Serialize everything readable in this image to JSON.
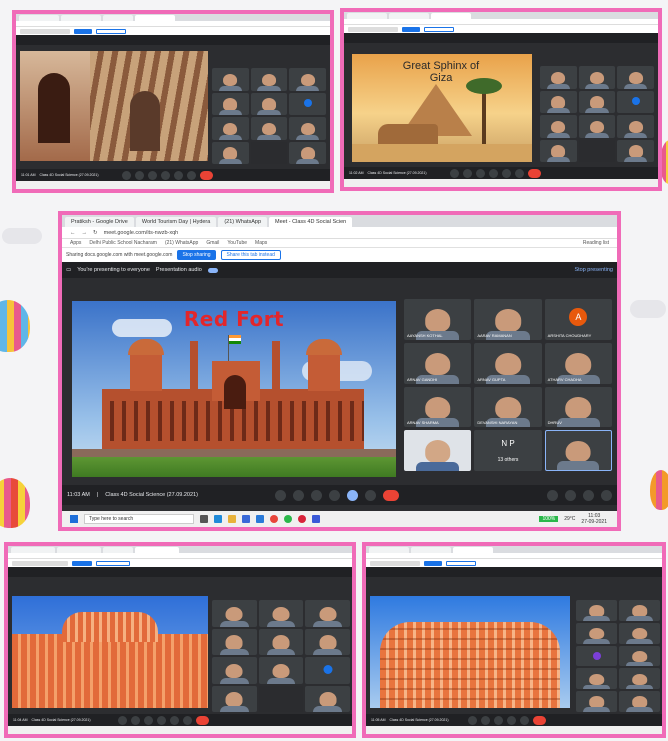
{
  "main": {
    "tabs": [
      "Pratiksh - Google Drive",
      "World Tourism Day | Hydera",
      "(21) WhatsApp",
      "Meet - Class 4D Social Scien"
    ],
    "url": "meet.google.com/its-nwzb-xqh",
    "bookmarks": [
      "Apps",
      "Delhi Public School Nacharam",
      "(21) WhatsApp",
      "Gmail",
      "YouTube",
      "Maps",
      "Reading list"
    ],
    "share_text": "Sharing docs.google.com with meet.google.com",
    "stop_label": "Stop sharing",
    "share_tab_label": "Share this tab instead",
    "presenting_text": "You're presenting to everyone",
    "audio_label": "Presentation audio",
    "stop_presenting": "Stop presenting",
    "slide_title": "Red Fort",
    "participants": [
      {
        "name": "AAYANSH KOTHAL"
      },
      {
        "name": "AARAV RAMANAN"
      },
      {
        "name": "ARSHITA CHOUDHARY",
        "initial": "A"
      },
      {
        "name": "ARNAV GANDHI"
      },
      {
        "name": "ARNAV GUPTA"
      },
      {
        "name": "ATHARV CHADHA"
      },
      {
        "name": "ARNAV SHARMA"
      },
      {
        "name": "DEVANSHI NARAYAN"
      },
      {
        "name": "DHRUV"
      },
      {
        "name": ""
      },
      {
        "name": "13 others",
        "initials": "N P"
      },
      {
        "name": ""
      }
    ],
    "time": "11:03 AM",
    "meeting": "Class 4D Social Science (27.09.2021)",
    "taskbar_search": "Type here to search",
    "temp": "29°C",
    "clock": "11:03",
    "date": "27-09-2021",
    "battery": "100%"
  },
  "thumb1": {
    "time": "11:01 AM",
    "meeting": "Class 4D Social Science (27.09.2021)"
  },
  "thumb2": {
    "slide_title": "Great Sphinx of Giza",
    "time": "11:02 AM",
    "meeting": "Class 4D Social Science (27.09.2021)"
  },
  "thumb3": {
    "time": "11:04 AM",
    "meeting": "Class 4D Social Science (27.09.2021)"
  },
  "thumb4": {
    "time": "11:05 AM",
    "meeting": "Class 4D Social Science (27.09.2021)"
  },
  "colors": {
    "frame": "#f06bb8",
    "meet_bg": "#202124",
    "end_call": "#ea4335",
    "accent": "#1a73e8"
  }
}
